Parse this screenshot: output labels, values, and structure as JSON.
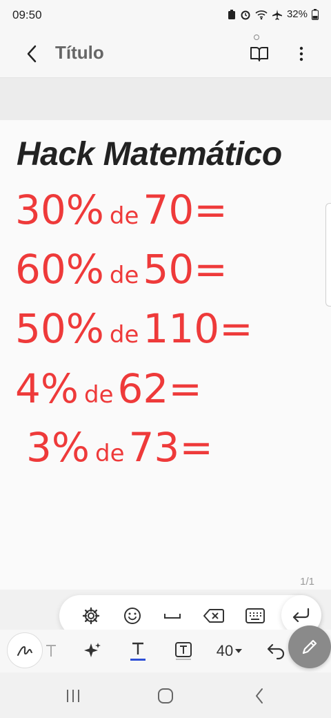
{
  "status": {
    "time": "09:50",
    "battery": "32%"
  },
  "app_bar": {
    "title": "Título"
  },
  "note": {
    "heading": "Hack Matemático",
    "lines": [
      {
        "percent": "30%",
        "de": "de",
        "number": "70",
        "eq": "="
      },
      {
        "percent": "60%",
        "de": "de",
        "number": "50",
        "eq": "="
      },
      {
        "percent": "50%",
        "de": "de",
        "number": "110",
        "eq": "="
      },
      {
        "percent": "4%",
        "de": "de",
        "number": "62",
        "eq": "="
      },
      {
        "percent": "3%",
        "de": "de",
        "number": "73",
        "eq": "="
      }
    ],
    "ink_color": "#ee3a3a",
    "page_count": "1/1"
  },
  "toolbar": {
    "font_size": "40"
  },
  "icons": {
    "settings": "gear-icon",
    "emoji": "smiley-icon",
    "space": "space-icon",
    "backspace": "backspace-icon",
    "keyboard": "keyboard-icon",
    "enter": "enter-icon"
  }
}
